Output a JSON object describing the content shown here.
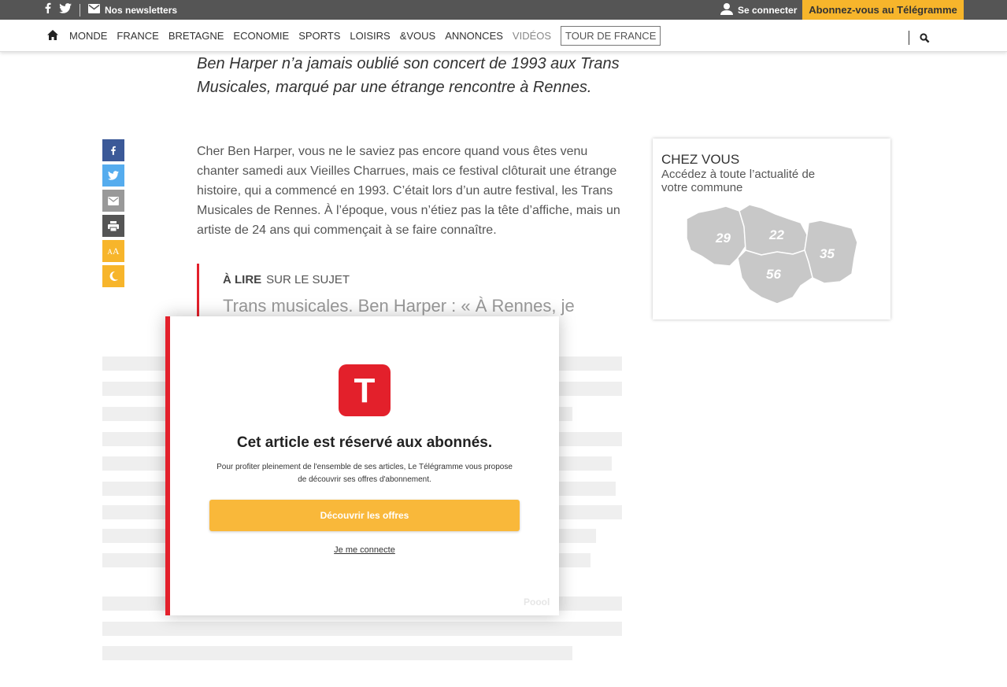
{
  "topbar": {
    "newsletters_label": "Nos newsletters",
    "login_label": "Se connecter",
    "subscribe_label": "Abonnez-vous au Télégramme",
    "colors": {
      "bar": "#555555",
      "accent": "#f7b52b"
    }
  },
  "nav": {
    "items": [
      {
        "label": "Monde"
      },
      {
        "label": "France"
      },
      {
        "label": "Bretagne"
      },
      {
        "label": "Economie"
      },
      {
        "label": "Sports"
      },
      {
        "label": "Loisirs"
      },
      {
        "label": "&Vous"
      },
      {
        "label": "Annonces"
      },
      {
        "label": "Vidéos"
      },
      {
        "label": "Tour de France"
      }
    ],
    "icons": {
      "home": "home-icon",
      "search": "search-icon"
    }
  },
  "article": {
    "lead": "Ben Harper n’a jamais oublié son concert de 1993 aux Trans Musicales, marqué par une étrange rencontre à Rennes.",
    "body": "Cher Ben Harper, vous ne le saviez pas encore quand vous êtes venu chanter samedi aux Vieilles Charrues, mais ce festival clôturait une étrange histoire, qui a commencé en 1993. C’était lors d’un autre festival, les Trans Musicales de Rennes. À l’époque, vous n’étiez pas la tête d’affiche, mais un artiste de 24 ans qui commençait à se faire connaître.",
    "related": {
      "label_bold": "À LIRE",
      "label_rest": "SUR LE SUJET",
      "title": "Trans musicales. Ben Harper : « À Rennes, je"
    }
  },
  "share": {
    "buttons": [
      {
        "name": "facebook",
        "icon": "facebook-icon",
        "glyph": "f",
        "color": "#3b5998"
      },
      {
        "name": "twitter",
        "icon": "twitter-icon",
        "glyph": "🐦",
        "color": "#55acee"
      },
      {
        "name": "email",
        "icon": "mail-icon",
        "glyph": "✉",
        "color": "#999999"
      },
      {
        "name": "print",
        "icon": "print-icon",
        "glyph": "⎙",
        "color": "#555555"
      },
      {
        "name": "text-size",
        "icon": "font-size-icon",
        "glyph": "AA",
        "color": "#f7b52b"
      },
      {
        "name": "night-mode",
        "icon": "moon-icon",
        "glyph": "☾",
        "color": "#f7b52b"
      }
    ]
  },
  "chez_vous": {
    "title": "CHEZ VOUS",
    "subtitle": "Accédez à toute l’actualité de votre commune",
    "departments": [
      "29",
      "22",
      "35",
      "56"
    ]
  },
  "paywall": {
    "logo_letter": "T",
    "title": "Cet article est réservé aux abonnés.",
    "text": "Pour profiter pleinement de l'ensemble de ses articles, Le Télégramme vous propose de découvrir ses offres d'abonnement.",
    "cta_label": "Découvrir les offres",
    "login_link": "Je me connecte",
    "provider": "Poool",
    "colors": {
      "red": "#e3202b",
      "cta": "#f9b83a"
    }
  }
}
